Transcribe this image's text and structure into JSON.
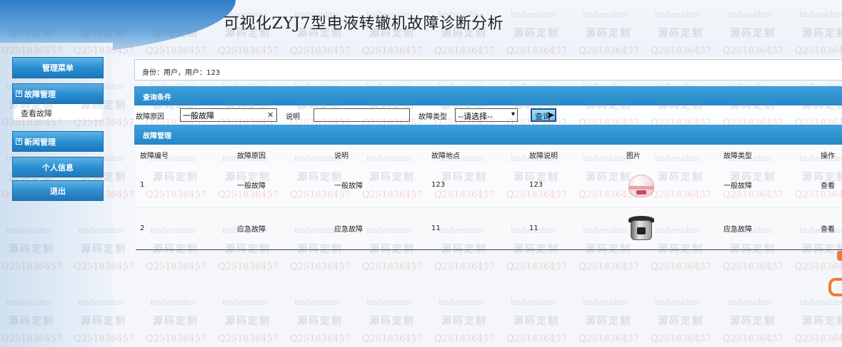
{
  "app": {
    "title": "可视化ZYJ7型电液转辙机故障诊断分析"
  },
  "watermark": {
    "line1": "bisheonline",
    "line2": "源码定制",
    "line3": "Q2518364 57",
    "line3_full": "Q2518364 57"
  },
  "sidebar": {
    "menu_header": "管理菜单",
    "groups": [
      {
        "label": "故障管理",
        "icon": "plus-box-icon",
        "items": [
          "查看故障"
        ]
      },
      {
        "label": "新闻管理",
        "icon": "plus-box-icon",
        "items": []
      }
    ],
    "profile_label": "个人信息",
    "logout_label": "退出"
  },
  "identity": {
    "text": "身份：用户，用户：123"
  },
  "query": {
    "header": "查询条件",
    "reason_label": "故障原因",
    "reason_value": "一般故障",
    "desc_label": "说明",
    "desc_value": "",
    "type_label": "故障类型",
    "type_selected": "--请选择--",
    "search_label": "查询"
  },
  "table": {
    "header": "故障管理",
    "columns": [
      "故障编号",
      "故障原因",
      "说明",
      "故障地点",
      "故障说明",
      "图片",
      "故障类型",
      "操作"
    ],
    "rows": [
      {
        "id": "1",
        "reason": "一般故障",
        "desc": "一般故障",
        "location": "123",
        "note": "123",
        "image": "rice-cooker-image",
        "type": "一般故障",
        "action": "查看"
      },
      {
        "id": "2",
        "reason": "应急故障",
        "desc": "应急故障",
        "location": "11",
        "note": "11",
        "image": "pressure-cooker-image",
        "type": "应急故障",
        "action": "查看"
      }
    ]
  },
  "colors": {
    "accent": "#2387c9",
    "button_gradient_top": "#5fb3e6",
    "button_gradient_bottom": "#1b78bd",
    "edge_mark": "#f07a33"
  }
}
